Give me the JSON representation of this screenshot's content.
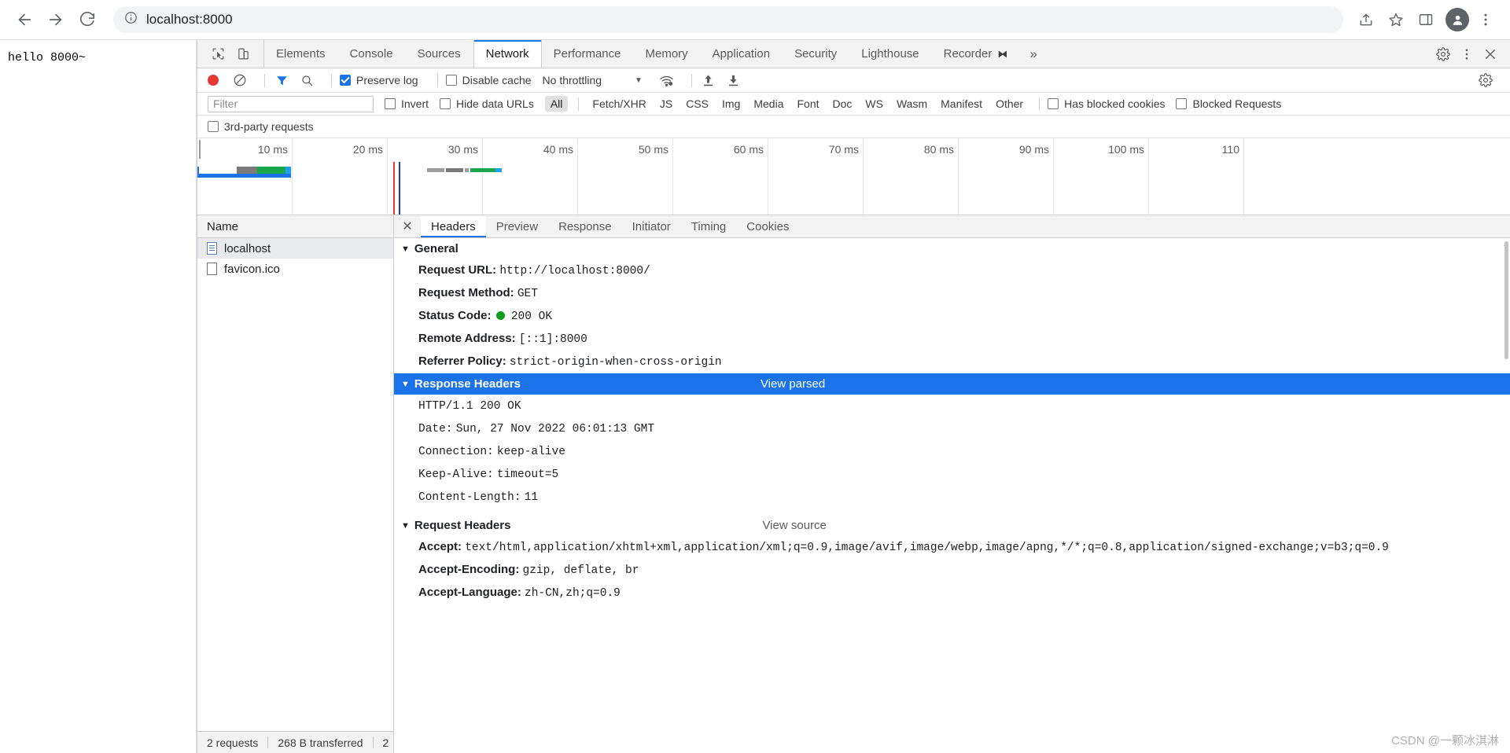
{
  "browser": {
    "back_label": "back-arrow",
    "forward_label": "forward-arrow",
    "reload_label": "reload",
    "url": "localhost:8000",
    "share_icon": "share-icon",
    "star_icon": "star-icon",
    "sidepanel_icon": "side-panel-icon",
    "profile_icon": "profile-avatar",
    "menu_icon": "kebab-menu-icon"
  },
  "page": {
    "body_text": "hello 8000~"
  },
  "devtools": {
    "tabs": [
      {
        "label": "Elements",
        "active": false
      },
      {
        "label": "Console",
        "active": false
      },
      {
        "label": "Sources",
        "active": false
      },
      {
        "label": "Network",
        "active": true
      },
      {
        "label": "Performance",
        "active": false
      },
      {
        "label": "Memory",
        "active": false
      },
      {
        "label": "Application",
        "active": false
      },
      {
        "label": "Security",
        "active": false
      },
      {
        "label": "Lighthouse",
        "active": false
      },
      {
        "label": "Recorder",
        "active": false,
        "badge": "⧓"
      }
    ],
    "more_tabs_label": "»",
    "settings_icon": "gear-icon",
    "more_icon": "kebab-menu-icon",
    "close_icon": "close-icon"
  },
  "network_toolbar": {
    "record_label": "record-button",
    "clear_label": "clear-button",
    "filter_toggle_label": "filter-funnel",
    "search_label": "search",
    "preserve_log": {
      "label": "Preserve log",
      "checked": true
    },
    "disable_cache": {
      "label": "Disable cache",
      "checked": false
    },
    "throttling": {
      "value": "No throttling",
      "caret": "▼"
    },
    "network_conditions_icon": "wifi-settings-icon",
    "import_icon": "import-har-icon",
    "export_icon": "export-har-icon",
    "settings_icon": "gear-icon"
  },
  "filter_bar": {
    "filter_placeholder": "Filter",
    "filter_value": "",
    "invert": {
      "label": "Invert",
      "checked": false
    },
    "hide_data_urls": {
      "label": "Hide data URLs",
      "checked": false
    },
    "types": [
      {
        "label": "All",
        "active": true
      },
      {
        "label": "Fetch/XHR",
        "active": false
      },
      {
        "label": "JS",
        "active": false
      },
      {
        "label": "CSS",
        "active": false
      },
      {
        "label": "Img",
        "active": false
      },
      {
        "label": "Media",
        "active": false
      },
      {
        "label": "Font",
        "active": false
      },
      {
        "label": "Doc",
        "active": false
      },
      {
        "label": "WS",
        "active": false
      },
      {
        "label": "Wasm",
        "active": false
      },
      {
        "label": "Manifest",
        "active": false
      },
      {
        "label": "Other",
        "active": false
      }
    ],
    "has_blocked_cookies": {
      "label": "Has blocked cookies",
      "checked": false
    },
    "blocked_requests": {
      "label": "Blocked Requests",
      "checked": false
    },
    "third_party_requests": {
      "label": "3rd-party requests",
      "checked": false
    }
  },
  "overview": {
    "ticks": [
      "10 ms",
      "20 ms",
      "30 ms",
      "40 ms",
      "50 ms",
      "60 ms",
      "70 ms",
      "80 ms",
      "90 ms",
      "100 ms",
      "110"
    ]
  },
  "request_list": {
    "column_header": "Name",
    "rows": [
      {
        "name": "localhost",
        "selected": true,
        "icon": "document-icon"
      },
      {
        "name": "favicon.ico",
        "selected": false,
        "icon": "generic-file-icon"
      }
    ],
    "footer": {
      "requests": "2 requests",
      "transferred": "268 B transferred",
      "resources": "2"
    }
  },
  "detail_panel": {
    "close_label": "✕",
    "tabs": [
      {
        "label": "Headers",
        "active": true
      },
      {
        "label": "Preview",
        "active": false
      },
      {
        "label": "Response",
        "active": false
      },
      {
        "label": "Initiator",
        "active": false
      },
      {
        "label": "Timing",
        "active": false
      },
      {
        "label": "Cookies",
        "active": false
      }
    ],
    "sections": [
      {
        "title": "General",
        "caret": "▼",
        "highlighted": false,
        "action": "",
        "rows": [
          {
            "key": "Request URL:",
            "value": "http://localhost:8000/"
          },
          {
            "key": "Request Method:",
            "value": "GET"
          },
          {
            "key": "Status Code:",
            "value": "200 OK",
            "status_dot": true
          },
          {
            "key": "Remote Address:",
            "value": "[::1]:8000"
          },
          {
            "key": "Referrer Policy:",
            "value": "strict-origin-when-cross-origin"
          }
        ]
      },
      {
        "title": "Response Headers",
        "caret": "▼",
        "highlighted": true,
        "action": "View parsed",
        "rows": [
          {
            "key": "",
            "value": "HTTP/1.1 200 OK"
          },
          {
            "key": "Date:",
            "value": "Sun, 27 Nov 2022 06:01:13 GMT"
          },
          {
            "key": "Connection:",
            "value": "keep-alive"
          },
          {
            "key": "Keep-Alive:",
            "value": "timeout=5"
          },
          {
            "key": "Content-Length:",
            "value": "11"
          }
        ]
      },
      {
        "title": "Request Headers",
        "caret": "▼",
        "highlighted": false,
        "action": "View source",
        "rows": [
          {
            "key": "Accept:",
            "value": "text/html,application/xhtml+xml,application/xml;q=0.9,image/avif,image/webp,image/apng,*/*;q=0.8,application/signed-exchange;v=b3;q=0.9"
          },
          {
            "key": "Accept-Encoding:",
            "value": "gzip, deflate, br"
          },
          {
            "key": "Accept-Language:",
            "value": "zh-CN,zh;q=0.9"
          }
        ]
      }
    ]
  },
  "watermark": {
    "text": "CSDN @一颗冰淇淋"
  },
  "colors": {
    "accent": "#1a73e8",
    "record_red": "#e53935",
    "status_green": "#0d9c1e",
    "toolbar_bg": "#f3f3f3"
  }
}
